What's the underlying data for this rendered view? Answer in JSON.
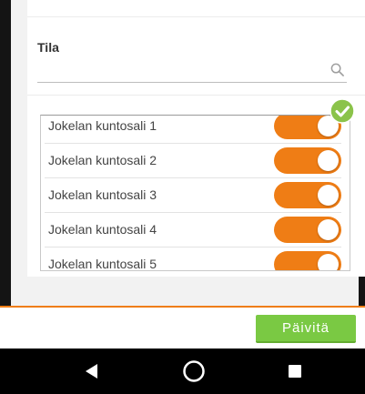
{
  "colors": {
    "accent_orange": "#ef7d15",
    "button_green": "#7ac943",
    "check_green": "#8bc34a"
  },
  "form": {
    "field_label": "Tila",
    "search_value": "",
    "search_icon": "search-icon"
  },
  "list": {
    "items": [
      {
        "label": "Jokelan kuntosali 1",
        "enabled": true
      },
      {
        "label": "Jokelan kuntosali 2",
        "enabled": true
      },
      {
        "label": "Jokelan kuntosali 3",
        "enabled": true
      },
      {
        "label": "Jokelan kuntosali 4",
        "enabled": true
      },
      {
        "label": "Jokelan kuntosali 5",
        "enabled": true
      }
    ]
  },
  "footer": {
    "update_label": "Päivitä"
  },
  "navbar": {
    "back_icon": "back-triangle-icon",
    "home_icon": "home-circle-icon",
    "recents_icon": "recents-square-icon"
  }
}
